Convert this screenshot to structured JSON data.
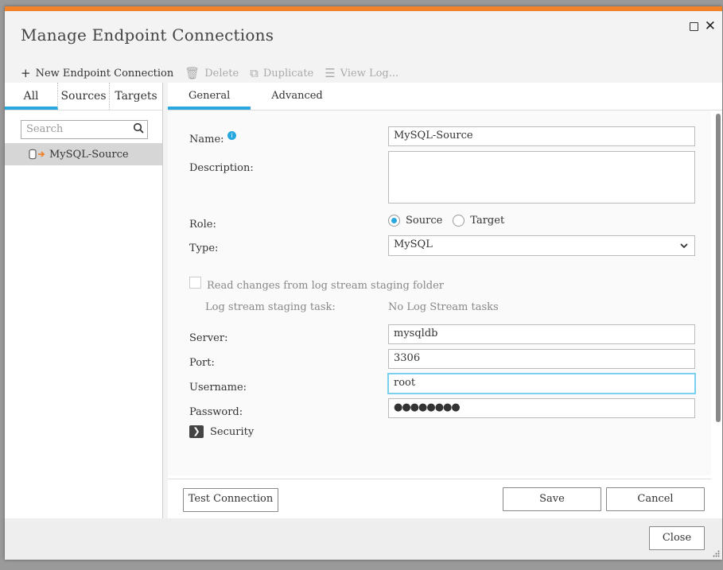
{
  "dialog": {
    "title": "Manage Endpoint Connections",
    "accent_color": "#f0822a"
  },
  "toolbar": {
    "new_label": "New Endpoint Connection",
    "delete_label": "Delete",
    "duplicate_label": "Duplicate",
    "view_log_label": "View Log..."
  },
  "left": {
    "tabs": [
      "All",
      "Sources",
      "Targets"
    ],
    "search_placeholder": "Search",
    "items": [
      {
        "label": "MySQL-Source"
      }
    ]
  },
  "right": {
    "tabs": [
      "General",
      "Advanced"
    ]
  },
  "form": {
    "name_label": "Name:",
    "name_value": "MySQL-Source",
    "description_label": "Description:",
    "description_value": "",
    "role_label": "Role:",
    "role_source": "Source",
    "role_target": "Target",
    "type_label": "Type:",
    "type_value": "MySQL",
    "log_stream_checkbox": "Read changes from log stream staging folder",
    "log_stream_task_label": "Log stream staging task:",
    "log_stream_task_value": "No Log Stream tasks",
    "server_label": "Server:",
    "server_value": "mysqldb",
    "port_label": "Port:",
    "port_value": "3306",
    "username_label": "Username:",
    "username_value": "root",
    "password_label": "Password:",
    "password_value": "●●●●●●●●",
    "security_label": "Security"
  },
  "buttons": {
    "test_connection": "Test Connection",
    "save": "Save",
    "cancel": "Cancel",
    "close": "Close"
  }
}
